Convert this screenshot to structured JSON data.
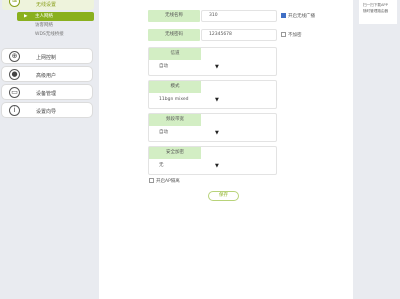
{
  "sidebar": {
    "group_title": "无线设置",
    "group_icon": "wifi-icon",
    "sub_items": [
      {
        "label": "主人网络",
        "active": true
      },
      {
        "label": "访客网络",
        "active": false
      },
      {
        "label": "WDS无线桥接",
        "active": false
      }
    ],
    "items": [
      {
        "label": "上网控制",
        "icon": "globe-icon"
      },
      {
        "label": "高级用户",
        "icon": "user-icon"
      },
      {
        "label": "设备管理",
        "icon": "device-icon"
      },
      {
        "label": "设置向导",
        "icon": "info-icon"
      }
    ]
  },
  "qr_panel": {
    "line1": "扫一扫下载APP",
    "line2": "随时管理路由器"
  },
  "form": {
    "ssid_label": "无线名称",
    "ssid_value": "310",
    "enable_broadcast_label": "开启无线广播",
    "enable_broadcast_checked": true,
    "password_label": "无线密码",
    "password_value": "12345678",
    "no_encrypt_label": "不加密",
    "no_encrypt_checked": false,
    "channel_label": "信道",
    "channel_value": "自动",
    "mode_label": "模式",
    "mode_value": "11bgn mixed",
    "bandwidth_label": "频段带宽",
    "bandwidth_value": "自动",
    "security_label": "安全加密",
    "security_value": "无",
    "ap_isolation_label": "开启AP隔离",
    "ap_isolation_checked": false,
    "save_label": "保存"
  }
}
